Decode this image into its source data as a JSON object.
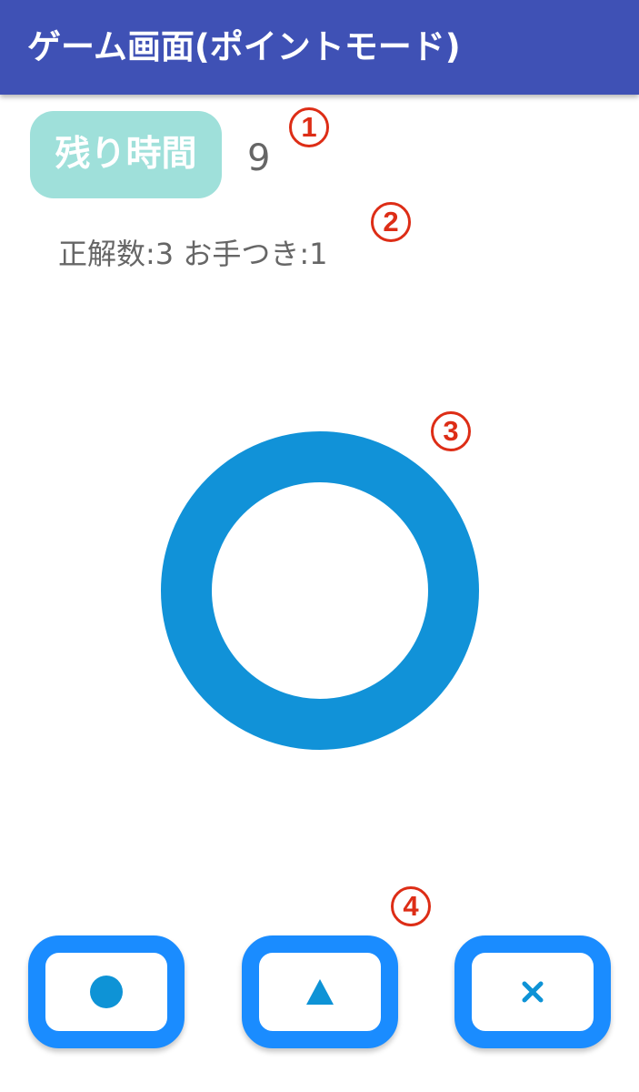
{
  "app_bar": {
    "title": "ゲーム画面(ポイントモード)",
    "color": "#3f51b5"
  },
  "timer": {
    "label": "残り時間",
    "value": "9",
    "badge_color": "#9fe0da"
  },
  "score": {
    "text": "正解数:3 お手つき:1"
  },
  "annotations": {
    "marker_1": "1",
    "marker_2": "2",
    "marker_3": "3",
    "marker_4": "4",
    "color": "#dd2d16"
  },
  "question": {
    "symbol": "circle-ring-icon",
    "color": "#1192d8"
  },
  "answer_buttons": [
    {
      "symbol": "filled-circle-icon",
      "color": "#0e93d6"
    },
    {
      "symbol": "triangle-icon",
      "color": "#0e93d6"
    },
    {
      "symbol": "cross-icon",
      "color": "#0e93d6"
    }
  ],
  "button_border_color": "#1a8cff"
}
